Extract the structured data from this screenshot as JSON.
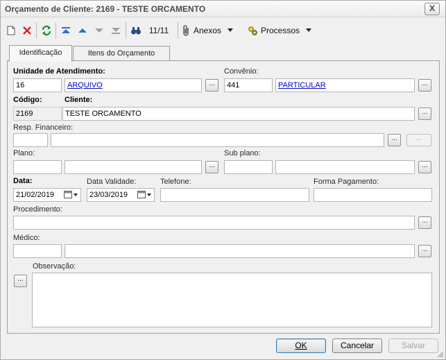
{
  "window": {
    "title": "Orçamento de Cliente: 2169 - TESTE ORCAMENTO",
    "close_label": "X"
  },
  "toolbar": {
    "icons": [
      "new-document-icon",
      "delete-icon",
      "refresh-icon",
      "first-record-icon",
      "previous-record-icon",
      "next-record-icon",
      "last-record-icon",
      "search-binoculars-icon"
    ],
    "record_counter": "11/11",
    "attachments_label": "Anexos",
    "processes_label": "Processos"
  },
  "tabs": [
    {
      "label": "Identificação",
      "active": true
    },
    {
      "label": "Itens do Orçamento",
      "active": false
    }
  ],
  "form": {
    "unidade_label": "Unidade de Atendimento:",
    "unidade_code": "16",
    "unidade_name": "ARQUIVO",
    "convenio_label": "Convênio:",
    "convenio_code": "441",
    "convenio_name": "PARTICULAR",
    "codigo_label": "Código:",
    "codigo_value": "2169",
    "cliente_label": "Cliente:",
    "cliente_value": "TESTE ORCAMENTO",
    "resp_label": "Resp. Financeiro:",
    "resp_code": "",
    "resp_name": "",
    "plano_label": "Plano:",
    "plano_code": "",
    "plano_name": "",
    "subplano_label": "Sub plano:",
    "subplano_code": "",
    "subplano_name": "",
    "data_label": "Data:",
    "data_value": "21/02/2019",
    "validade_label": "Data Validade:",
    "validade_value": "23/03/2019",
    "telefone_label": "Telefone:",
    "telefone_value": "",
    "pagamento_label": "Forma Pagamento:",
    "pagamento_value": "",
    "procedimento_label": "Procedimento:",
    "procedimento_value": "",
    "medico_label": "Médico:",
    "medico_code": "",
    "medico_name": "",
    "observacao_label": "Observação:",
    "observacao_value": "",
    "ellipsis": "..."
  },
  "buttons": {
    "ok": "OK",
    "cancel": "Cancelar",
    "save": "Salvar"
  },
  "colors": {
    "link": "#0000cc",
    "accent_blue": "#3c7fb1"
  }
}
